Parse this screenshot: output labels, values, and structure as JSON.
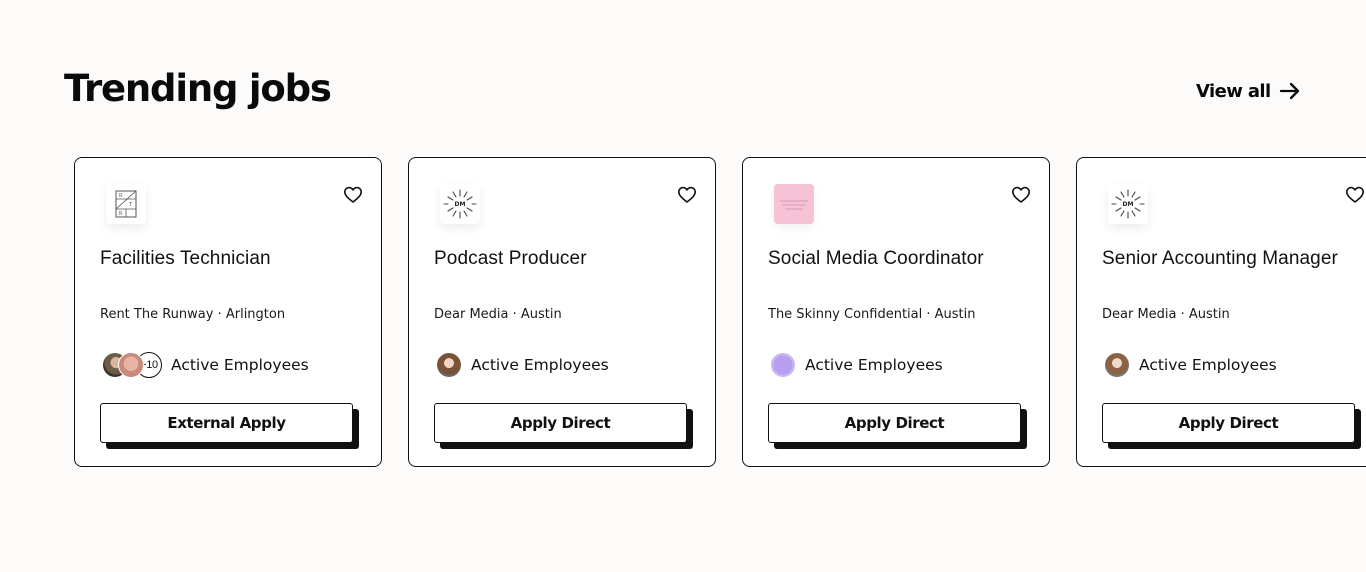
{
  "section": {
    "title": "Trending jobs",
    "view_all_label": "View all"
  },
  "jobs": [
    {
      "title": "Facilities Technician",
      "company": "Rent The Runway",
      "location": "Arlington",
      "company_line": "Rent The Runway · Arlington",
      "logo": "rent-the-runway-logo",
      "employees_extra": "+10",
      "employees_label": "Active Employees",
      "apply_label": "External Apply"
    },
    {
      "title": "Podcast Producer",
      "company": "Dear Media",
      "location": "Austin",
      "company_line": "Dear Media · Austin",
      "logo": "dear-media-logo",
      "logo_text": "DM",
      "employees_label": "Active Employees",
      "apply_label": "Apply Direct"
    },
    {
      "title": "Social Media Coordinator",
      "company": "The Skinny Confidential",
      "location": "Austin",
      "company_line": "The Skinny Confidential · Austin",
      "logo": "skinny-confidential-logo",
      "logo_color": "#f6c3d6",
      "employees_label": "Active Employees",
      "apply_label": "Apply Direct"
    },
    {
      "title": "Senior Accounting Manager",
      "company": "Dear Media",
      "location": "Austin",
      "company_line": "Dear Media · Austin",
      "logo": "dear-media-logo",
      "logo_text": "DM",
      "employees_label": "Active Employees",
      "apply_label": "Apply Direct"
    }
  ],
  "icons": {
    "heart": "heart-outline-icon",
    "arrow": "arrow-right-icon"
  }
}
